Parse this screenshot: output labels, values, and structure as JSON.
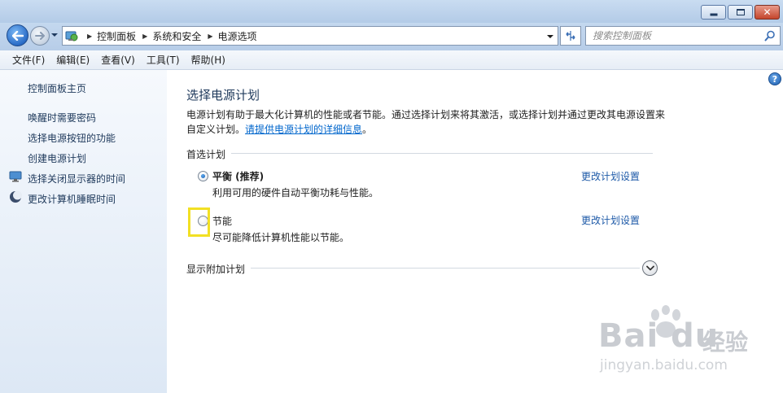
{
  "window": {
    "minimize_icon": "minimize-icon",
    "maximize_icon": "maximize-icon",
    "close_icon": "close-icon"
  },
  "nav": {
    "breadcrumbs": [
      "控制面板",
      "系统和安全",
      "电源选项"
    ],
    "search_placeholder": "搜索控制面板"
  },
  "menu": [
    "文件(F)",
    "编辑(E)",
    "查看(V)",
    "工具(T)",
    "帮助(H)"
  ],
  "sidebar": {
    "home": "控制面板主页",
    "links": [
      "唤醒时需要密码",
      "选择电源按钮的功能",
      "创建电源计划",
      "选择关闭显示器的时间",
      "更改计算机睡眠时间"
    ]
  },
  "main": {
    "title": "选择电源计划",
    "desc_text": "电源计划有助于最大化计算机的性能或者节能。通过选择计划来将其激活，或选择计划并通过更改其电源设置来自定义计划。",
    "desc_link": "请提供电源计划的详细信息",
    "desc_end": "。",
    "preferred_label": "首选计划",
    "plans": [
      {
        "name": "平衡 (推荐)",
        "desc": "利用可用的硬件自动平衡功耗与性能。",
        "link": "更改计划设置",
        "selected": true
      },
      {
        "name": "节能",
        "desc": "尽可能降低计算机性能以节能。",
        "link": "更改计划设置",
        "selected": false
      }
    ],
    "more_label": "显示附加计划"
  },
  "help_label": "?",
  "watermark": {
    "brand": "Bai du",
    "brand_cn": "经验",
    "url": "jingyan.baidu.com"
  },
  "colors": {
    "accent": "#1e5aa8",
    "heading": "#1e395b",
    "highlight": "#f2e024"
  }
}
